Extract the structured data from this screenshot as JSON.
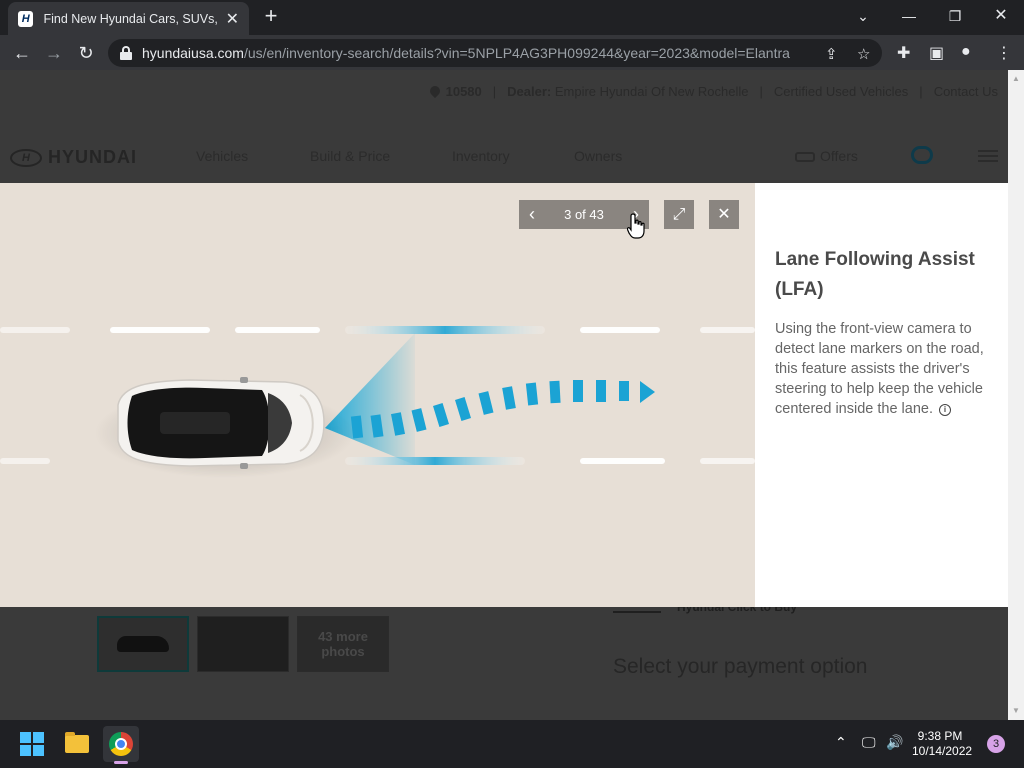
{
  "browser": {
    "tab_title": "Find New Hyundai Cars, SUVs, Hy",
    "url_host": "hyundaiusa.com",
    "url_path": "/us/en/inventory-search/details?vin=5NPLP4AG3PH099244&year=2023&model=Elantra"
  },
  "site": {
    "zip": "10580",
    "dealer_label": "Dealer:",
    "dealer_name": "Empire Hyundai Of New Rochelle",
    "certified_link": "Certified Used Vehicles",
    "contact_link": "Contact Us",
    "logo_text": "HYUNDAI",
    "nav": [
      "Vehicles",
      "Build & Price",
      "Inventory",
      "Owners"
    ],
    "offers_label": "Offers",
    "more_photos": "43 more photos",
    "click_to_buy": "Hyundai Click to Buy",
    "payment_title": "Select your payment option"
  },
  "gallery": {
    "counter": "3 of 43",
    "feature_title": "Lane Following Assist (LFA)",
    "feature_description": "Using the front-view camera to detect lane markers on the road, this feature assists the driver's steering to help keep the vehicle centered inside the lane."
  },
  "taskbar": {
    "time": "9:38 PM",
    "date": "10/14/2022",
    "notification_count": "3"
  },
  "colors": {
    "accent_cyan": "#1ba3d4",
    "image_bg": "#e7dfd6",
    "control_bg": "#8a8580"
  }
}
